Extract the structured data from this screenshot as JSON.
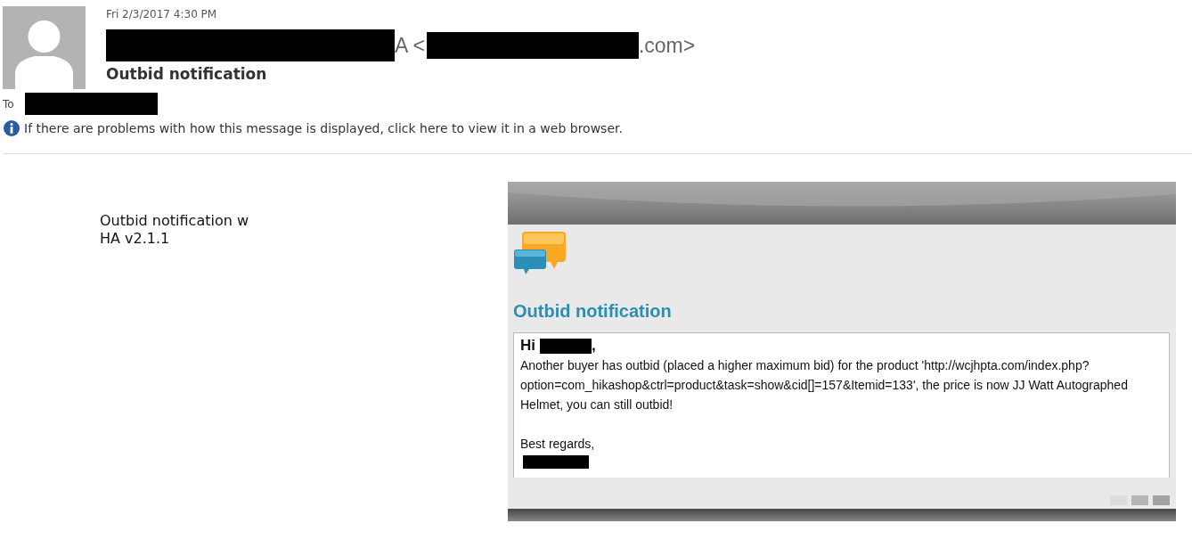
{
  "header": {
    "date": "Fri 2/3/2017 4:30 PM",
    "sender_tail": "A <",
    "sender_domain": ".com>",
    "subject": "Outbid notification",
    "to_label": "To",
    "info": "If there are problems with how this message is displayed, click here to view it in a web browser."
  },
  "note": [
    "Outbid notification w",
    "HA v2.1.1"
  ],
  "email": {
    "heading": "Outbid notification",
    "greeting": "Hi",
    "greeting_end": ",",
    "body": "Another buyer has outbid (placed a higher maximum bid) for the product 'http://wcjhpta.com/index.php?option=com_hikashop&ctrl=product&task=show&cid[]=157&Itemid=133', the price is now JJ Watt Autographed Helmet, you can still outbid!",
    "closing": "Best regards,"
  }
}
